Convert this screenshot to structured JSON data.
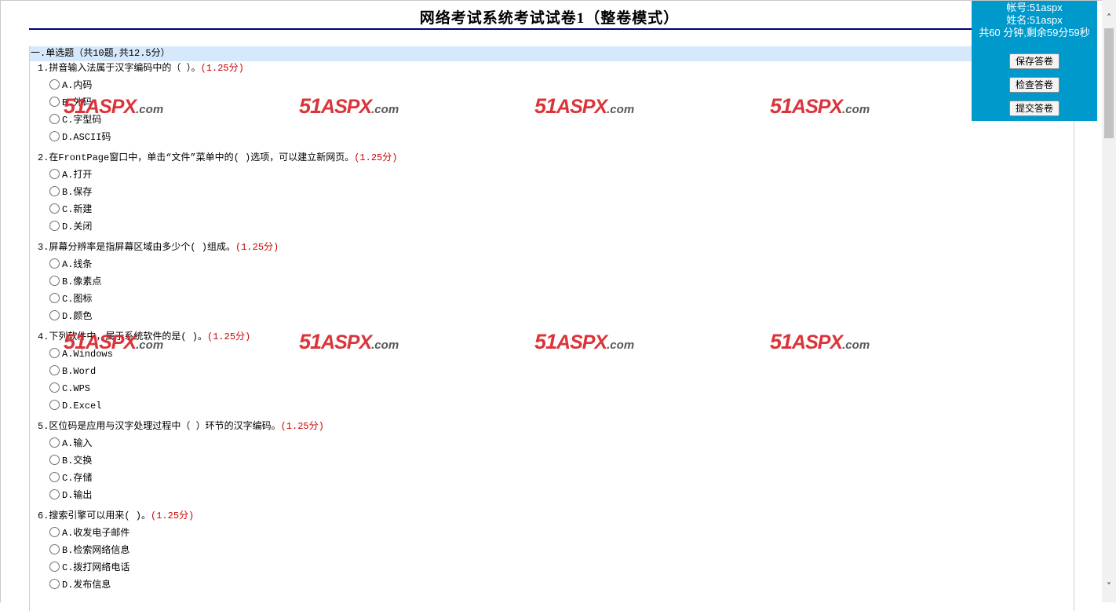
{
  "page": {
    "title": "网络考试系统考试试卷1（整卷模式）"
  },
  "info_panel": {
    "account": "帐号:51aspx",
    "name": "姓名:51aspx",
    "timer": "共60 分钟,剩余59分59秒",
    "save_label": "保存答卷",
    "check_label": "检查答卷",
    "submit_label": "提交答卷"
  },
  "section": {
    "header": "一.单选题（共10题,共12.5分）"
  },
  "watermark": {
    "num": "51",
    "aspx": "ASPX",
    "com": ".com"
  },
  "questions": [
    {
      "text": "1.拼音输入法属于汉字编码中的（ ）。",
      "score": "(1.25分)",
      "options": [
        "A.内码",
        "B.外码",
        "C.字型码",
        "D.ASCII码"
      ]
    },
    {
      "text": "2.在FrontPage窗口中，单击“文件”菜单中的( )选项，可以建立新网页。",
      "score": "(1.25分)",
      "options": [
        "A.打开",
        "B.保存",
        "C.新建",
        "D.关闭"
      ]
    },
    {
      "text": "3.屏幕分辨率是指屏幕区域由多少个( )组成。",
      "score": "(1.25分)",
      "options": [
        "A.线条",
        "B.像素点",
        "C.图标",
        "D.颜色"
      ]
    },
    {
      "text": "4.下列软件中，属于系统软件的是( )。",
      "score": "(1.25分)",
      "options": [
        "A.Windows",
        "B.Word",
        "C.WPS",
        "D.Excel"
      ]
    },
    {
      "text": "5.区位码是应用与汉字处理过程中（ ）环节的汉字编码。",
      "score": "(1.25分)",
      "options": [
        "A.输入",
        "B.交换",
        "C.存储",
        "D.输出"
      ]
    },
    {
      "text": "6.搜索引擎可以用来( )。",
      "score": "(1.25分)",
      "options": [
        "A.收发电子邮件",
        "B.检索网络信息",
        "C.拨打网络电话",
        "D.发布信息"
      ]
    }
  ]
}
